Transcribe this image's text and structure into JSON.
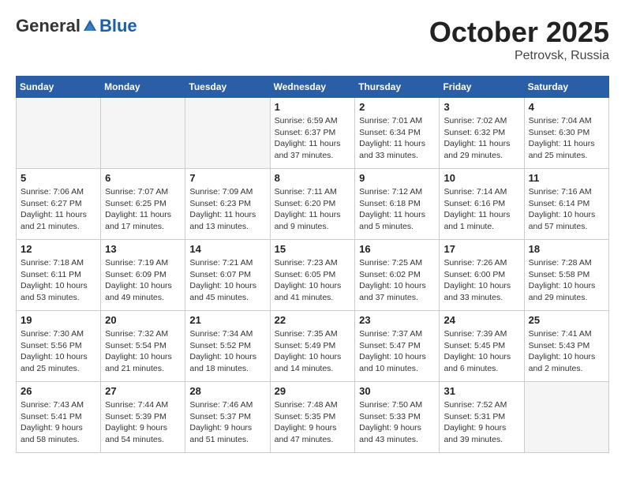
{
  "header": {
    "logo_general": "General",
    "logo_blue": "Blue",
    "month": "October 2025",
    "location": "Petrovsk, Russia"
  },
  "weekdays": [
    "Sunday",
    "Monday",
    "Tuesday",
    "Wednesday",
    "Thursday",
    "Friday",
    "Saturday"
  ],
  "weeks": [
    [
      {
        "day": "",
        "info": ""
      },
      {
        "day": "",
        "info": ""
      },
      {
        "day": "",
        "info": ""
      },
      {
        "day": "1",
        "info": "Sunrise: 6:59 AM\nSunset: 6:37 PM\nDaylight: 11 hours\nand 37 minutes."
      },
      {
        "day": "2",
        "info": "Sunrise: 7:01 AM\nSunset: 6:34 PM\nDaylight: 11 hours\nand 33 minutes."
      },
      {
        "day": "3",
        "info": "Sunrise: 7:02 AM\nSunset: 6:32 PM\nDaylight: 11 hours\nand 29 minutes."
      },
      {
        "day": "4",
        "info": "Sunrise: 7:04 AM\nSunset: 6:30 PM\nDaylight: 11 hours\nand 25 minutes."
      }
    ],
    [
      {
        "day": "5",
        "info": "Sunrise: 7:06 AM\nSunset: 6:27 PM\nDaylight: 11 hours\nand 21 minutes."
      },
      {
        "day": "6",
        "info": "Sunrise: 7:07 AM\nSunset: 6:25 PM\nDaylight: 11 hours\nand 17 minutes."
      },
      {
        "day": "7",
        "info": "Sunrise: 7:09 AM\nSunset: 6:23 PM\nDaylight: 11 hours\nand 13 minutes."
      },
      {
        "day": "8",
        "info": "Sunrise: 7:11 AM\nSunset: 6:20 PM\nDaylight: 11 hours\nand 9 minutes."
      },
      {
        "day": "9",
        "info": "Sunrise: 7:12 AM\nSunset: 6:18 PM\nDaylight: 11 hours\nand 5 minutes."
      },
      {
        "day": "10",
        "info": "Sunrise: 7:14 AM\nSunset: 6:16 PM\nDaylight: 11 hours\nand 1 minute."
      },
      {
        "day": "11",
        "info": "Sunrise: 7:16 AM\nSunset: 6:14 PM\nDaylight: 10 hours\nand 57 minutes."
      }
    ],
    [
      {
        "day": "12",
        "info": "Sunrise: 7:18 AM\nSunset: 6:11 PM\nDaylight: 10 hours\nand 53 minutes."
      },
      {
        "day": "13",
        "info": "Sunrise: 7:19 AM\nSunset: 6:09 PM\nDaylight: 10 hours\nand 49 minutes."
      },
      {
        "day": "14",
        "info": "Sunrise: 7:21 AM\nSunset: 6:07 PM\nDaylight: 10 hours\nand 45 minutes."
      },
      {
        "day": "15",
        "info": "Sunrise: 7:23 AM\nSunset: 6:05 PM\nDaylight: 10 hours\nand 41 minutes."
      },
      {
        "day": "16",
        "info": "Sunrise: 7:25 AM\nSunset: 6:02 PM\nDaylight: 10 hours\nand 37 minutes."
      },
      {
        "day": "17",
        "info": "Sunrise: 7:26 AM\nSunset: 6:00 PM\nDaylight: 10 hours\nand 33 minutes."
      },
      {
        "day": "18",
        "info": "Sunrise: 7:28 AM\nSunset: 5:58 PM\nDaylight: 10 hours\nand 29 minutes."
      }
    ],
    [
      {
        "day": "19",
        "info": "Sunrise: 7:30 AM\nSunset: 5:56 PM\nDaylight: 10 hours\nand 25 minutes."
      },
      {
        "day": "20",
        "info": "Sunrise: 7:32 AM\nSunset: 5:54 PM\nDaylight: 10 hours\nand 21 minutes."
      },
      {
        "day": "21",
        "info": "Sunrise: 7:34 AM\nSunset: 5:52 PM\nDaylight: 10 hours\nand 18 minutes."
      },
      {
        "day": "22",
        "info": "Sunrise: 7:35 AM\nSunset: 5:49 PM\nDaylight: 10 hours\nand 14 minutes."
      },
      {
        "day": "23",
        "info": "Sunrise: 7:37 AM\nSunset: 5:47 PM\nDaylight: 10 hours\nand 10 minutes."
      },
      {
        "day": "24",
        "info": "Sunrise: 7:39 AM\nSunset: 5:45 PM\nDaylight: 10 hours\nand 6 minutes."
      },
      {
        "day": "25",
        "info": "Sunrise: 7:41 AM\nSunset: 5:43 PM\nDaylight: 10 hours\nand 2 minutes."
      }
    ],
    [
      {
        "day": "26",
        "info": "Sunrise: 7:43 AM\nSunset: 5:41 PM\nDaylight: 9 hours\nand 58 minutes."
      },
      {
        "day": "27",
        "info": "Sunrise: 7:44 AM\nSunset: 5:39 PM\nDaylight: 9 hours\nand 54 minutes."
      },
      {
        "day": "28",
        "info": "Sunrise: 7:46 AM\nSunset: 5:37 PM\nDaylight: 9 hours\nand 51 minutes."
      },
      {
        "day": "29",
        "info": "Sunrise: 7:48 AM\nSunset: 5:35 PM\nDaylight: 9 hours\nand 47 minutes."
      },
      {
        "day": "30",
        "info": "Sunrise: 7:50 AM\nSunset: 5:33 PM\nDaylight: 9 hours\nand 43 minutes."
      },
      {
        "day": "31",
        "info": "Sunrise: 7:52 AM\nSunset: 5:31 PM\nDaylight: 9 hours\nand 39 minutes."
      },
      {
        "day": "",
        "info": ""
      }
    ]
  ]
}
